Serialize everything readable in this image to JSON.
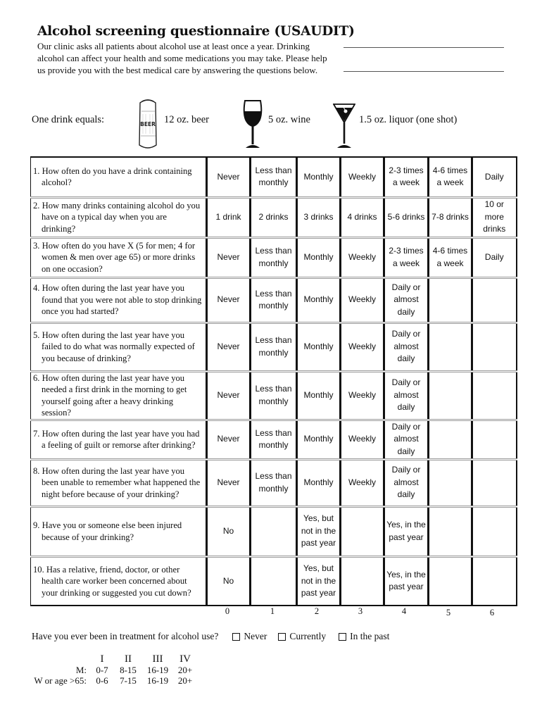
{
  "header": {
    "title": "Alcohol screening questionnaire (USAUDIT)",
    "intro": "Our clinic asks all patients about alcohol use at least once a year. Drinking alcohol can affect your health and some medications you may take. Please help us provide you with the best medical care by answering the questions below."
  },
  "signature_lines": [
    {
      "name": "blank-line-1",
      "value": ""
    },
    {
      "name": "blank-line-2",
      "value": ""
    }
  ],
  "drink_equivalents": {
    "label": "One drink equals:",
    "items": [
      {
        "icon": "beer-can-icon",
        "label": "12 oz. beer"
      },
      {
        "icon": "wine-glass-icon",
        "label": "5 oz. wine"
      },
      {
        "icon": "martini-glass-icon",
        "label": "1.5 oz. liquor (one shot)"
      }
    ]
  },
  "questions": [
    {
      "text": "1. How often do you have a drink containing alcohol?",
      "options": [
        "Never",
        "Less than monthly",
        "Monthly",
        "Weekly",
        "2-3 times a week",
        "4-6 times a week",
        "Daily"
      ]
    },
    {
      "text": "2. How many drinks containing alcohol do you have on a typical day when you are drinking?",
      "options": [
        "1 drink",
        "2 drinks",
        "3 drinks",
        "4 drinks",
        "5-6 drinks",
        "7-8 drinks",
        "10 or more drinks"
      ]
    },
    {
      "text": "3. How often do you have X (5 for men; 4 for women & men over age 65) or more drinks on one occasion?",
      "options": [
        "Never",
        "Less than monthly",
        "Monthly",
        "Weekly",
        "2-3 times a week",
        "4-6 times a week",
        "Daily"
      ]
    },
    {
      "text": "4. How often during the last year have you found that you were not able to stop drinking once you had started?",
      "options": [
        "Never",
        "Less than monthly",
        "Monthly",
        "Weekly",
        "Daily or almost daily",
        "",
        ""
      ]
    },
    {
      "text": "5. How often during the last year have you failed to do what was normally expected of you because of drinking?",
      "options": [
        "Never",
        "Less than monthly",
        "Monthly",
        "Weekly",
        "Daily or almost daily",
        "",
        ""
      ]
    },
    {
      "text": "6. How often during the last year have you needed a first drink in the morning to get yourself going after a heavy drinking session?",
      "options": [
        "Never",
        "Less than monthly",
        "Monthly",
        "Weekly",
        "Daily or almost daily",
        "",
        ""
      ]
    },
    {
      "text": "7. How often during the last year have you had a feeling of guilt or remorse after drinking?",
      "options": [
        "Never",
        "Less than monthly",
        "Monthly",
        "Weekly",
        "Daily or almost daily",
        "",
        ""
      ]
    },
    {
      "text": "8. How often during the last year have you been unable to remember what happened the night before because of your drinking?",
      "options": [
        "Never",
        "Less than monthly",
        "Monthly",
        "Weekly",
        "Daily or almost daily",
        "",
        ""
      ]
    },
    {
      "text": "9. Have you or someone else been injured because of your drinking?",
      "options": [
        "No",
        "",
        "Yes, but not in the past year",
        "",
        "Yes, in the past year",
        "",
        ""
      ]
    },
    {
      "text": "10. Has a relative, friend, doctor, or other health care worker been concerned about your drinking or suggested you cut down?",
      "options": [
        "No",
        "",
        "Yes, but not in the past year",
        "",
        "Yes, in the past year",
        "",
        ""
      ]
    }
  ],
  "score_values": [
    "0",
    "1",
    "2",
    "3",
    "4",
    "5",
    "6"
  ],
  "treatment": {
    "question": "Have you ever been in treatment for alcohol use?",
    "options": [
      {
        "label": "Never",
        "checked": false
      },
      {
        "label": "Currently",
        "checked": false
      },
      {
        "label": "In the past",
        "checked": false
      }
    ]
  },
  "scoring_zones": {
    "headers": [
      "I",
      "II",
      "III",
      "IV"
    ],
    "rows": [
      {
        "label": "M:",
        "values": [
          "0-7",
          "8-15",
          "16-19",
          "20+"
        ]
      },
      {
        "label": "W or age >65:",
        "values": [
          "0-6",
          "7-15",
          "16-19",
          "20+"
        ]
      }
    ]
  }
}
